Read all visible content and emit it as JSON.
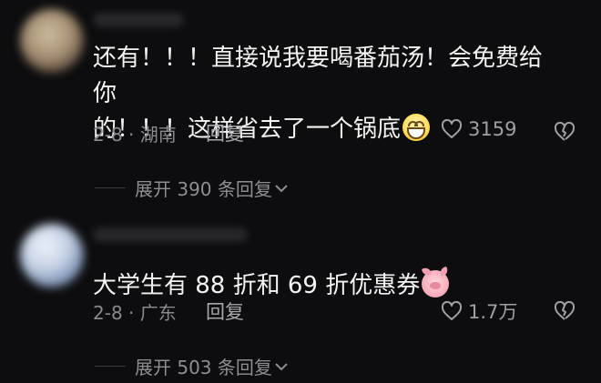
{
  "comments": [
    {
      "text_lines": [
        "还有！！！直接说我要喝番茄汤！会免费给你",
        "的！！！这样省去了一个锅底"
      ],
      "emoji": "grinning-face",
      "date_location": "2-8 · 湖南",
      "reply_label": "回复",
      "likes": "3159",
      "expand_label": "展开 390 条回复"
    },
    {
      "text_lines": [
        "大学生有 88 折和 69 折优惠券"
      ],
      "emoji": "pig-face",
      "date_location": "2-8 · 广东",
      "reply_label": "回复",
      "likes": "1.7万",
      "expand_label": "展开 503 条回复"
    }
  ],
  "colors": {
    "background": "#0d0d0f",
    "text": "#f3f3f3",
    "muted": "#8a8a8e"
  }
}
